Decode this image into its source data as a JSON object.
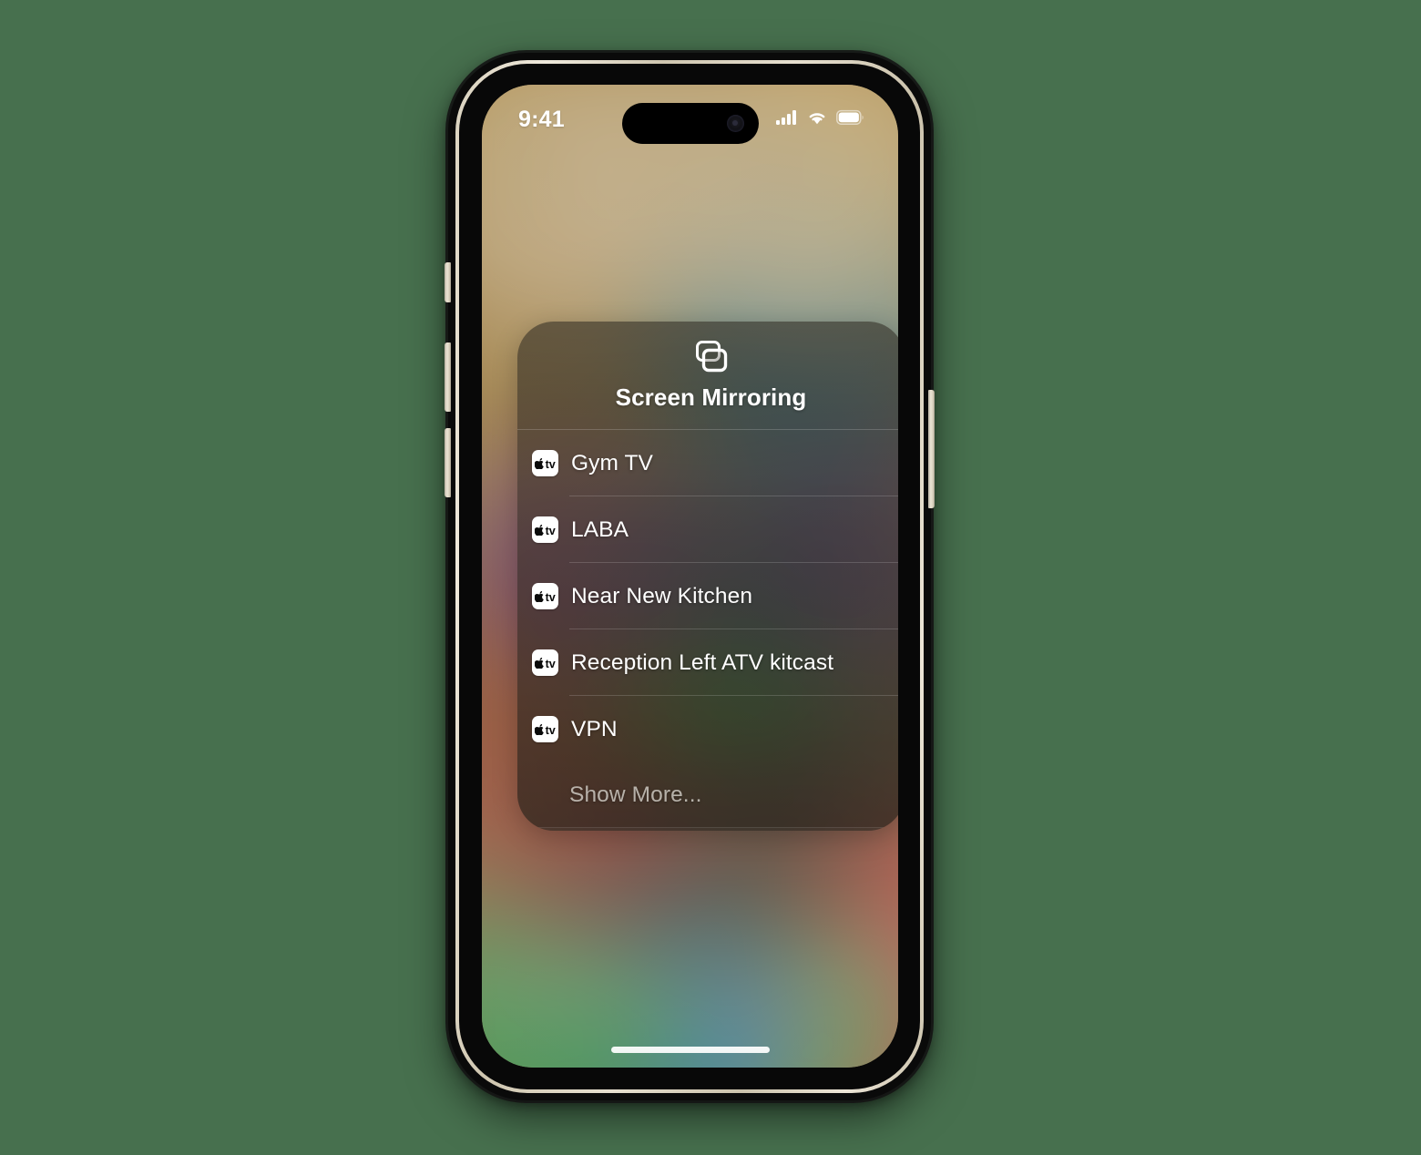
{
  "background_color": "#47704e",
  "device": {
    "kind": "iphone",
    "frame_color": "#0a0a0a",
    "rail_color": "#e6dfcf",
    "buttons": [
      {
        "name": "action-button",
        "side": "left"
      },
      {
        "name": "volume-up-button",
        "side": "left"
      },
      {
        "name": "volume-down-button",
        "side": "left"
      },
      {
        "name": "power-button",
        "side": "right"
      }
    ]
  },
  "status_bar": {
    "time": "9:41",
    "cellular_icon": "signal-bars-icon",
    "cellular_bars": 4,
    "wifi_icon": "wifi-icon",
    "battery_icon": "battery-icon",
    "battery_level_percent": 100,
    "dynamic_island": "dynamic-island",
    "camera_icon": "front-camera-icon"
  },
  "panel": {
    "icon": "screen-mirroring-icon",
    "title": "Screen Mirroring",
    "devices": [
      {
        "icon": "apple-tv-icon",
        "name": "Gym TV"
      },
      {
        "icon": "apple-tv-icon",
        "name": "LABA"
      },
      {
        "icon": "apple-tv-icon",
        "name": "Near New Kitchen"
      },
      {
        "icon": "apple-tv-icon",
        "name": "Reception Left ATV kitcast"
      },
      {
        "icon": "apple-tv-icon",
        "name": "VPN"
      }
    ],
    "show_more_label": "Show More...",
    "accent_text_color": "#ffffff",
    "muted_text_color": "#e8e4de"
  },
  "home_indicator": "home-indicator"
}
